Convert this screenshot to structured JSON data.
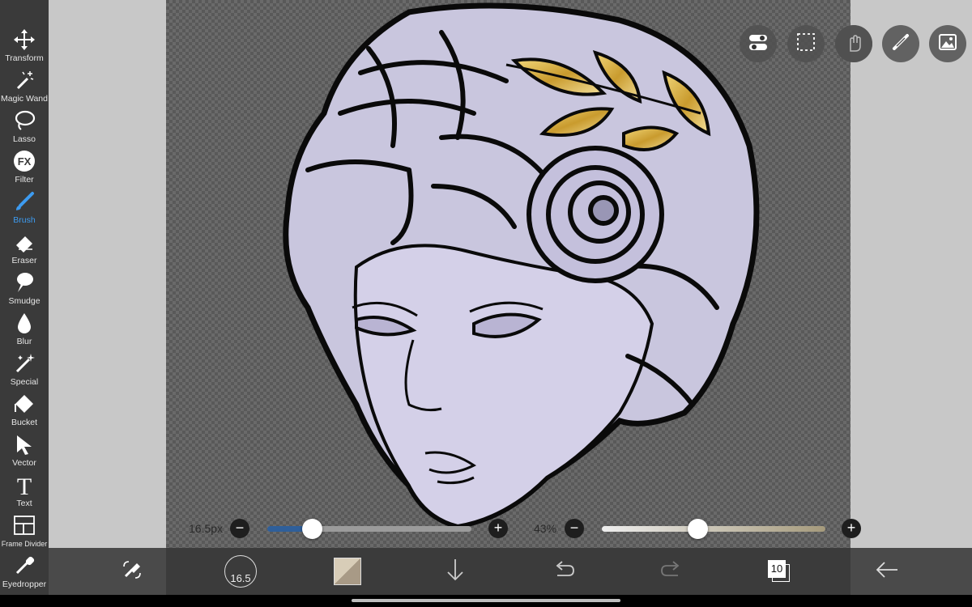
{
  "toolbar": {
    "items": [
      {
        "label": "Transform",
        "icon": "move-arrows-icon"
      },
      {
        "label": "Magic Wand",
        "icon": "magic-wand-icon"
      },
      {
        "label": "Lasso",
        "icon": "lasso-icon"
      },
      {
        "label": "Filter",
        "icon": "fx-icon",
        "glyph": "FX"
      },
      {
        "label": "Brush",
        "icon": "brush-icon",
        "active": true
      },
      {
        "label": "Eraser",
        "icon": "eraser-icon"
      },
      {
        "label": "Smudge",
        "icon": "smudge-icon"
      },
      {
        "label": "Blur",
        "icon": "blur-drop-icon"
      },
      {
        "label": "Special",
        "icon": "sparkle-wand-icon"
      },
      {
        "label": "Bucket",
        "icon": "bucket-icon"
      },
      {
        "label": "Vector",
        "icon": "pointer-arrow-icon"
      },
      {
        "label": "Text",
        "icon": "text-icon",
        "glyph": "T"
      },
      {
        "label": "Frame Divider",
        "icon": "frame-divider-icon"
      },
      {
        "label": "Eyedropper",
        "icon": "eyedropper-icon"
      }
    ]
  },
  "top_actions": [
    {
      "icon": "toggle-settings-icon"
    },
    {
      "icon": "selection-rectangle-icon"
    },
    {
      "icon": "hand-touch-icon"
    },
    {
      "icon": "ruler-pencil-icon"
    },
    {
      "icon": "image-gallery-icon"
    }
  ],
  "sliders": {
    "brush_size": {
      "label": "16.5px",
      "value_fraction": 0.22
    },
    "opacity": {
      "label": "43%",
      "value_fraction": 0.43
    },
    "minus": "−",
    "plus": "+"
  },
  "bottombar": {
    "brush_size_value": "16.5",
    "layers_count": "10",
    "icons": [
      "swap-tools-icon",
      "brush-size-icon",
      "color-swatch-icon",
      "download-arrow-icon",
      "undo-icon",
      "redo-icon",
      "layers-icon",
      "back-arrow-icon"
    ]
  },
  "colors": {
    "accent": "#3d9bf0",
    "toolbar_bg": "#3a3a3a",
    "margin_gray": "#c8c8c8",
    "hair": "#c9c5dc",
    "skin": "#c7c3de",
    "gold": "#d9b54a",
    "brush_track": "#2f5f9a"
  }
}
